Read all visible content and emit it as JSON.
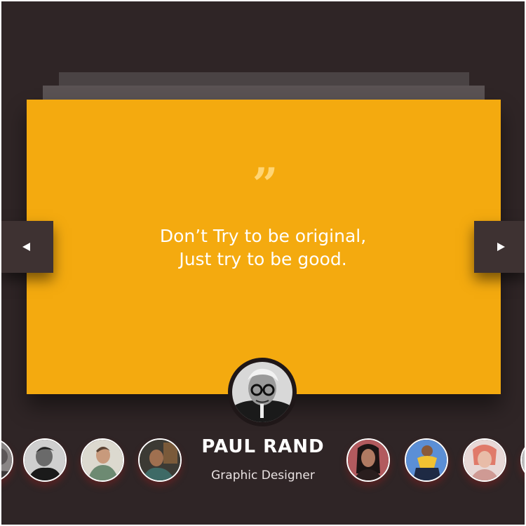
{
  "testimonial": {
    "quote_mark": "”",
    "quote_lines": [
      "Don’t Try to be original,",
      "Just try to be good."
    ],
    "name": "PAUL RAND",
    "role": "Graphic Designer"
  },
  "navigation": {
    "prev_icon": "chevron-left-icon",
    "next_icon": "chevron-right-icon"
  },
  "colors": {
    "background": "#2f2526",
    "card": "#f4aa0f",
    "quote_mark": "#ffd574",
    "nav_button": "#3e3232"
  }
}
